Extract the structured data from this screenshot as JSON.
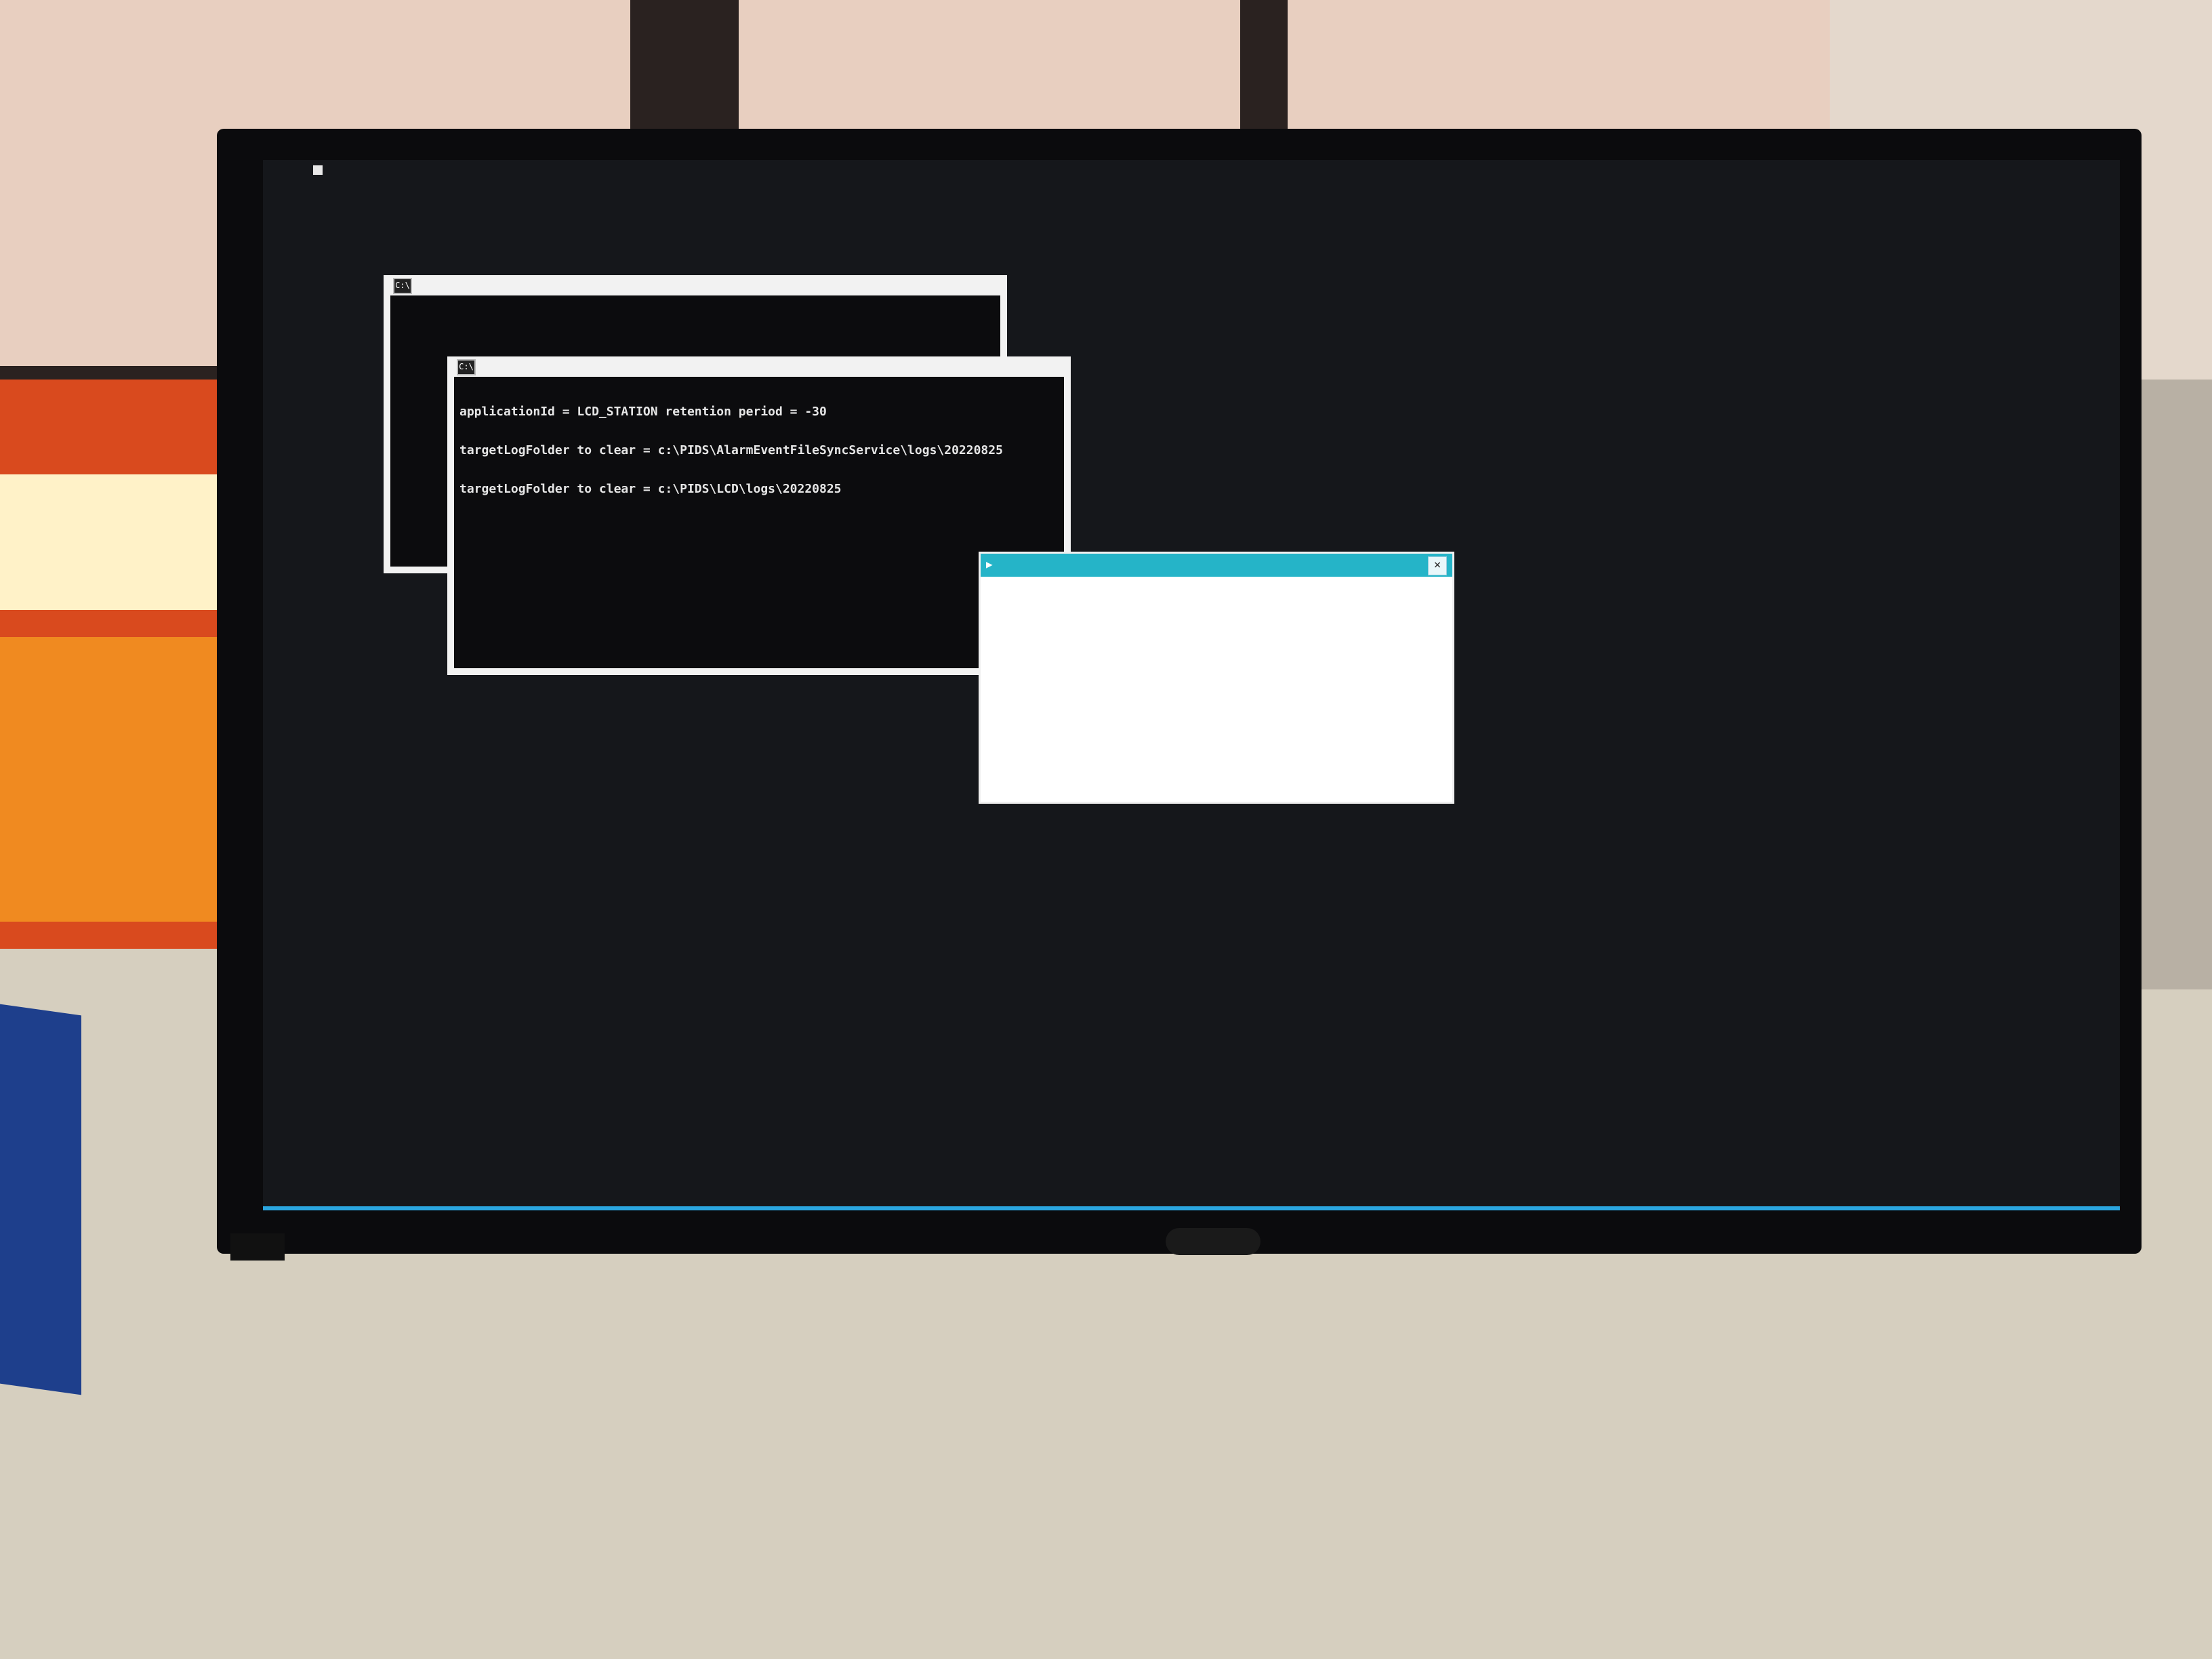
{
  "console_back": {
    "icon_text": "C:\\",
    "title": ""
  },
  "console_front": {
    "icon_text": "C:\\",
    "title": "",
    "lines": [
      "applicationId = LCD_STATION retention period = -30",
      "targetLogFolder to clear = c:\\PIDS\\AlarmEventFileSyncService\\logs\\20220825",
      "targetLogFolder to clear = c:\\PIDS\\LCD\\logs\\20220825"
    ]
  },
  "dialog": {
    "title": "",
    "close_glyph": "×",
    "icon": "app-icon"
  },
  "colors": {
    "taskbar_accent": "#2aa6e0",
    "dialog_titlebar": "#25b4c8",
    "console_bg": "#0c0c0e",
    "desktop_bg": "#15171b"
  }
}
